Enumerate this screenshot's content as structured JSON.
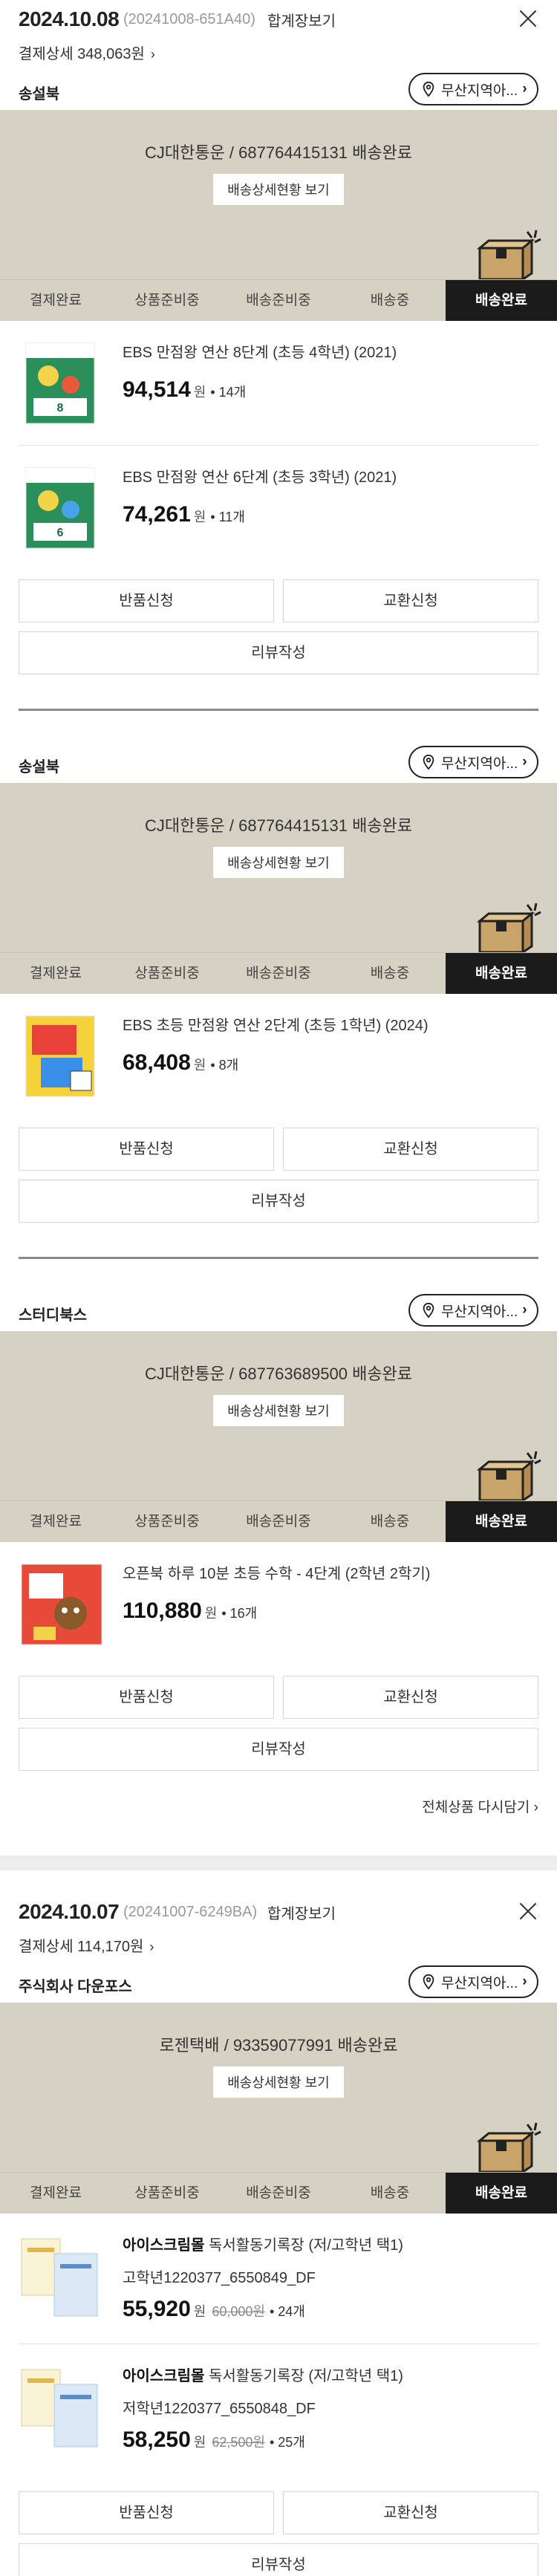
{
  "orders": [
    {
      "date": "2024.10.08",
      "order_no": "(20241008-651A40)",
      "together_label": "합계장보기",
      "pay_detail": "결제상세 348,063원",
      "shipments": [
        {
          "seller": "송설북",
          "region_btn": "무산지역아...",
          "tracking": "CJ대한통운 / 687764415131 배송완료",
          "track_btn": "배송상세현황 보기",
          "steps": [
            "결제완료",
            "상품준비중",
            "배송준비중",
            "배송중",
            "배송완료"
          ],
          "items": [
            {
              "name": "EBS 만점왕 연산 8단계 (초등 4학년) (2021)",
              "price": "94,514",
              "won": "원",
              "qty": "• 14개"
            },
            {
              "name": "EBS 만점왕 연산 6단계 (초등 3학년) (2021)",
              "price": "74,261",
              "won": "원",
              "qty": "• 11개"
            }
          ],
          "return_btn": "반품신청",
          "exchange_btn": "교환신청",
          "review_btn": "리뷰작성"
        },
        {
          "seller": "송설북",
          "region_btn": "무산지역아...",
          "tracking": "CJ대한통운 / 687764415131 배송완료",
          "track_btn": "배송상세현황 보기",
          "steps": [
            "결제완료",
            "상품준비중",
            "배송준비중",
            "배송중",
            "배송완료"
          ],
          "items": [
            {
              "name": "EBS 초등 만점왕 연산 2단계 (초등 1학년) (2024)",
              "price": "68,408",
              "won": "원",
              "qty": "• 8개"
            }
          ],
          "return_btn": "반품신청",
          "exchange_btn": "교환신청",
          "review_btn": "리뷰작성"
        },
        {
          "seller": "스터디북스",
          "region_btn": "무산지역아...",
          "tracking": "CJ대한통운 / 687763689500 배송완료",
          "track_btn": "배송상세현황 보기",
          "steps": [
            "결제완료",
            "상품준비중",
            "배송준비중",
            "배송중",
            "배송완료"
          ],
          "items": [
            {
              "name": "오픈북 하루 10분 초등 수학 - 4단계 (2학년 2학기)",
              "price": "110,880",
              "won": "원",
              "qty": "• 16개"
            }
          ],
          "return_btn": "반품신청",
          "exchange_btn": "교환신청",
          "review_btn": "리뷰작성"
        }
      ],
      "reorder": "전체상품 다시담기"
    },
    {
      "date": "2024.10.07",
      "order_no": "(20241007-6249BA)",
      "together_label": "합계장보기",
      "pay_detail": "결제상세 114,170원",
      "shipments": [
        {
          "seller": "주식회사 다운포스",
          "region_btn": "무산지역아...",
          "tracking": "로젠택배 / 93359077991 배송완료",
          "track_btn": "배송상세현황 보기",
          "steps": [
            "결제완료",
            "상품준비중",
            "배송준비중",
            "배송중",
            "배송완료"
          ],
          "items": [
            {
              "brand": "아이스크림몰",
              "name": "독서활동기록장 (저/고학년 택1)",
              "option": "고학년1220377_6550849_DF",
              "price": "55,920",
              "won": "원",
              "orig": "60,000원",
              "qty": "• 24개"
            },
            {
              "brand": "아이스크림몰",
              "name": "독서활동기록장 (저/고학년 택1)",
              "option": "저학년1220377_6550848_DF",
              "price": "58,250",
              "won": "원",
              "orig": "62,500원",
              "qty": "• 25개"
            }
          ],
          "return_btn": "반품신청",
          "exchange_btn": "교환신청",
          "review_btn": "리뷰작성"
        }
      ]
    }
  ],
  "colors": {
    "track_bg": "#d5d1c3",
    "active_step": "#1b1b1b",
    "box": "#c9a46a"
  },
  "icons": {
    "close": "close-icon",
    "pin": "location-pin-icon",
    "box": "delivery-box-icon",
    "chevron": "chevron-right-icon"
  }
}
